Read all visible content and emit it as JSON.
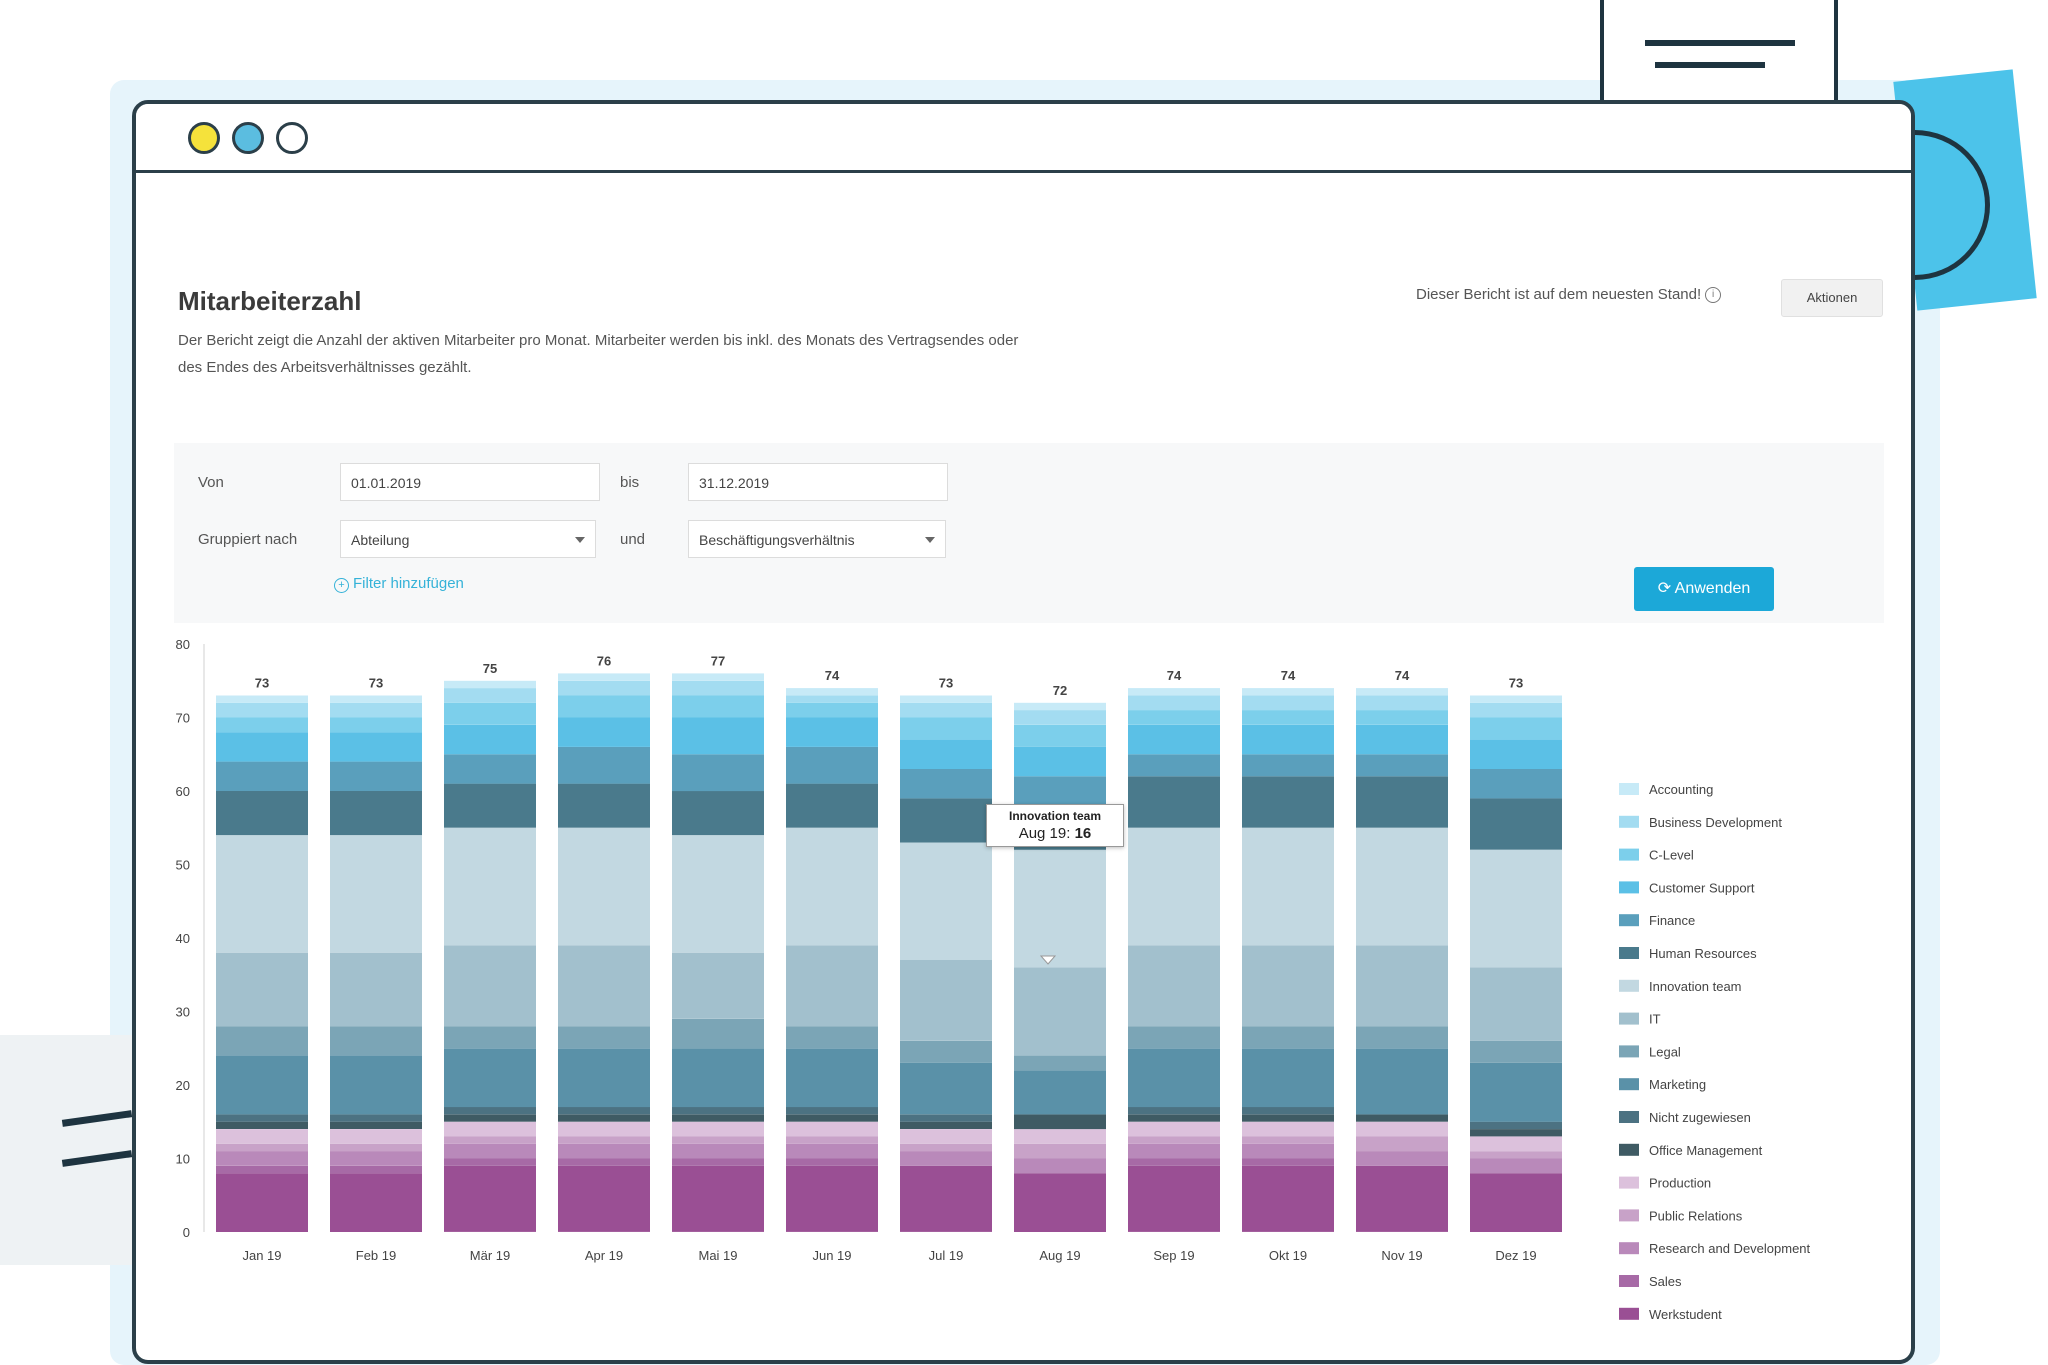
{
  "window": {
    "dots": [
      "yellow",
      "blue",
      "white"
    ]
  },
  "page": {
    "title": "Mitarbeiterzahl",
    "description": "Der Bericht zeigt die Anzahl der aktiven Mitarbeiter pro Monat. Mitarbeiter werden bis inkl. des Monats des Vertragsendes oder des Endes des Arbeitsverhältnisses gezählt.",
    "status_text": "Dieser Bericht ist auf dem neuesten Stand!",
    "status_icon": "info-icon",
    "actions_label": "Aktionen"
  },
  "filters": {
    "from_label": "Von",
    "from_value": "01.01.2019",
    "to_label": "bis",
    "to_value": "31.12.2019",
    "group_label": "Gruppiert nach",
    "group_value": "Abteilung",
    "and_label": "und",
    "group2_value": "Beschäftigungsverhältnis",
    "add_filter_label": "Filter hinzufügen",
    "apply_label": "Anwenden",
    "apply_icon": "refresh-icon"
  },
  "tooltip": {
    "title": "Innovation team",
    "label": "Aug 19:",
    "value": "16"
  },
  "chart_data": {
    "type": "bar",
    "stacked": true,
    "categories": [
      "Jan 19",
      "Feb 19",
      "Mär 19",
      "Apr 19",
      "Mai 19",
      "Jun 19",
      "Jul 19",
      "Aug 19",
      "Sep 19",
      "Okt 19",
      "Nov 19",
      "Dez 19"
    ],
    "totals": [
      73,
      73,
      75,
      76,
      77,
      74,
      73,
      72,
      74,
      74,
      74,
      73
    ],
    "ylim": [
      0,
      80
    ],
    "yticks": [
      0,
      10,
      20,
      30,
      40,
      50,
      60,
      70,
      80
    ],
    "legend_position": "right",
    "series": [
      {
        "name": "Werkstudent",
        "color": "#9a4f94",
        "values": [
          8,
          8,
          9,
          9,
          9,
          9,
          9,
          8,
          9,
          9,
          9,
          8
        ]
      },
      {
        "name": "Sales",
        "color": "#a76aa6",
        "values": [
          1,
          1,
          1,
          1,
          1,
          1,
          0,
          0,
          1,
          1,
          0,
          0
        ]
      },
      {
        "name": "Research and Development",
        "color": "#b989ba",
        "values": [
          2,
          2,
          2,
          2,
          2,
          2,
          2,
          2,
          2,
          2,
          2,
          2
        ]
      },
      {
        "name": "Public Relations",
        "color": "#c8a2c8",
        "values": [
          1,
          1,
          1,
          1,
          1,
          1,
          1,
          2,
          1,
          1,
          2,
          1
        ]
      },
      {
        "name": "Production",
        "color": "#dcc1dc",
        "values": [
          2,
          2,
          2,
          2,
          2,
          2,
          2,
          2,
          2,
          2,
          2,
          2
        ]
      },
      {
        "name": "Office Management",
        "color": "#3f5b64",
        "values": [
          1,
          1,
          1,
          1,
          1,
          1,
          1,
          2,
          1,
          1,
          1,
          1
        ]
      },
      {
        "name": "Nicht zugewiesen",
        "color": "#4c7282",
        "values": [
          1,
          1,
          1,
          1,
          1,
          1,
          1,
          0,
          1,
          1,
          0,
          1
        ]
      },
      {
        "name": "Marketing",
        "color": "#5a91a8",
        "values": [
          8,
          8,
          8,
          8,
          8,
          8,
          7,
          6,
          8,
          8,
          9,
          8
        ]
      },
      {
        "name": "Legal",
        "color": "#7ba5b6",
        "values": [
          4,
          4,
          3,
          3,
          4,
          3,
          3,
          2,
          3,
          3,
          3,
          3
        ]
      },
      {
        "name": "IT",
        "color": "#a2c0cd",
        "values": [
          10,
          10,
          11,
          11,
          9,
          11,
          11,
          12,
          11,
          11,
          11,
          10
        ]
      },
      {
        "name": "Innovation team",
        "color": "#c2d8e1",
        "values": [
          16,
          16,
          16,
          16,
          16,
          16,
          16,
          16,
          16,
          16,
          16,
          16
        ]
      },
      {
        "name": "Human Resources",
        "color": "#4a7a8c",
        "values": [
          6,
          6,
          6,
          6,
          6,
          6,
          6,
          6,
          7,
          7,
          7,
          7
        ]
      },
      {
        "name": "Finance",
        "color": "#5a9fbc",
        "values": [
          4,
          4,
          4,
          5,
          5,
          5,
          4,
          4,
          3,
          3,
          3,
          4
        ]
      },
      {
        "name": "Customer Support",
        "color": "#5bc0e6",
        "values": [
          4,
          4,
          4,
          4,
          5,
          4,
          4,
          4,
          4,
          4,
          4,
          4
        ]
      },
      {
        "name": "C-Level",
        "color": "#7ccfeb",
        "values": [
          2,
          2,
          3,
          3,
          3,
          2,
          3,
          3,
          2,
          2,
          2,
          3
        ]
      },
      {
        "name": "Business Development",
        "color": "#a3dcf1",
        "values": [
          2,
          2,
          2,
          2,
          2,
          1,
          2,
          2,
          2,
          2,
          2,
          2
        ]
      },
      {
        "name": "Accounting",
        "color": "#c7eaf7",
        "values": [
          1,
          1,
          1,
          1,
          1,
          1,
          1,
          1,
          1,
          1,
          1,
          1
        ]
      }
    ]
  }
}
